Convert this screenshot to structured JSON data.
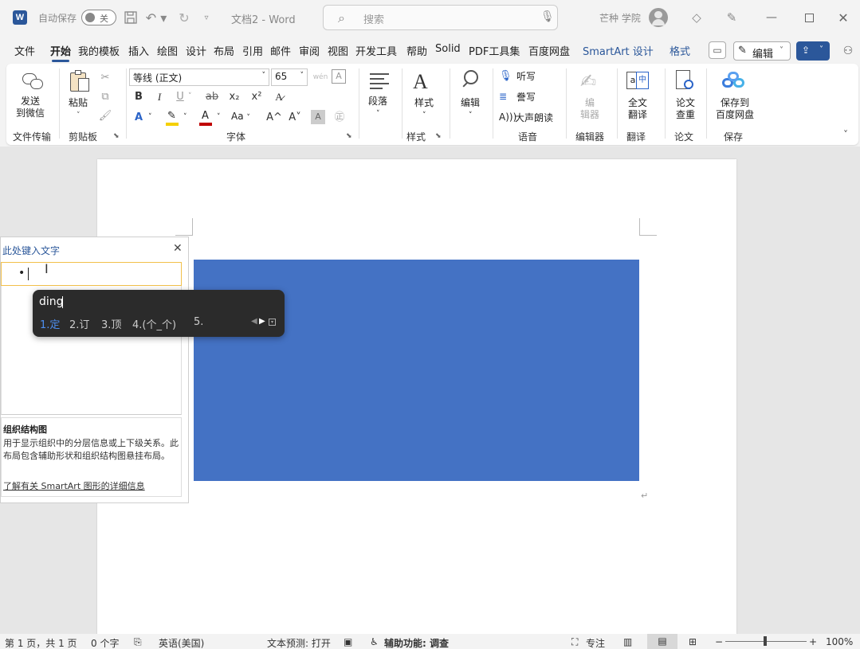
{
  "titlebar": {
    "autosave_label": "自动保存",
    "autosave_state": "关",
    "doc_title": "文档2 - Word",
    "search_placeholder": "搜索",
    "user_name": "芒种 学院"
  },
  "menu": {
    "items": [
      "文件",
      "开始",
      "我的模板",
      "插入",
      "绘图",
      "设计",
      "布局",
      "引用",
      "邮件",
      "审阅",
      "视图",
      "开发工具",
      "帮助",
      "Solid",
      "PDF工具集",
      "百度网盘"
    ],
    "context_tabs": [
      "SmartArt 设计",
      "格式"
    ],
    "edit_label": "编辑"
  },
  "ribbon": {
    "wechat": {
      "label1": "发送",
      "label2": "到微信",
      "group": "文件传输"
    },
    "clipboard": {
      "paste": "粘贴",
      "group": "剪贴板"
    },
    "font": {
      "name": "等线 (正文)",
      "size": "65",
      "group": "字体",
      "bold": "B",
      "italic": "I",
      "underline": "U",
      "strike": "ab",
      "sub": "x₂",
      "sup": "x²",
      "aa": "Aa",
      "grow": "A^",
      "shrink": "A˅"
    },
    "paragraph": {
      "label": "段落"
    },
    "styles": {
      "label": "样式",
      "group": "样式"
    },
    "editing": {
      "label": "编辑"
    },
    "voice": {
      "listen": "听写",
      "transcribe": "誊写",
      "read": "大声朗读",
      "group": "语音"
    },
    "editor": {
      "label1": "编",
      "label2": "辑器",
      "group": "编辑器"
    },
    "translate": {
      "label1": "全文",
      "label2": "翻译",
      "group": "翻译"
    },
    "paper": {
      "label1": "论文",
      "label2": "查重",
      "group": "论文"
    },
    "save": {
      "label1": "保存到",
      "label2": "百度网盘",
      "group": "保存"
    }
  },
  "smartart_panel": {
    "title": "此处键入文字",
    "bullet": "•",
    "desc_title": "组织结构图",
    "desc_text": "用于显示组织中的分层信息或上下级关系。此布局包含辅助形状和组织结构图悬挂布局。",
    "link": "了解有关 SmartArt 图形的详细信息"
  },
  "ime": {
    "input": "ding",
    "candidates": [
      "1.定",
      "2.订",
      "3.顶",
      "4.(个_个)",
      "5."
    ]
  },
  "status": {
    "page": "第 1 页，共 1 页",
    "words": "0 个字",
    "lang": "英语(美国)",
    "predict": "文本预测: 打开",
    "access": "辅助功能: 调查",
    "focus": "专注",
    "zoom": "100%"
  },
  "colors": {
    "accent": "#2b579a",
    "shape": "#4472c4"
  }
}
